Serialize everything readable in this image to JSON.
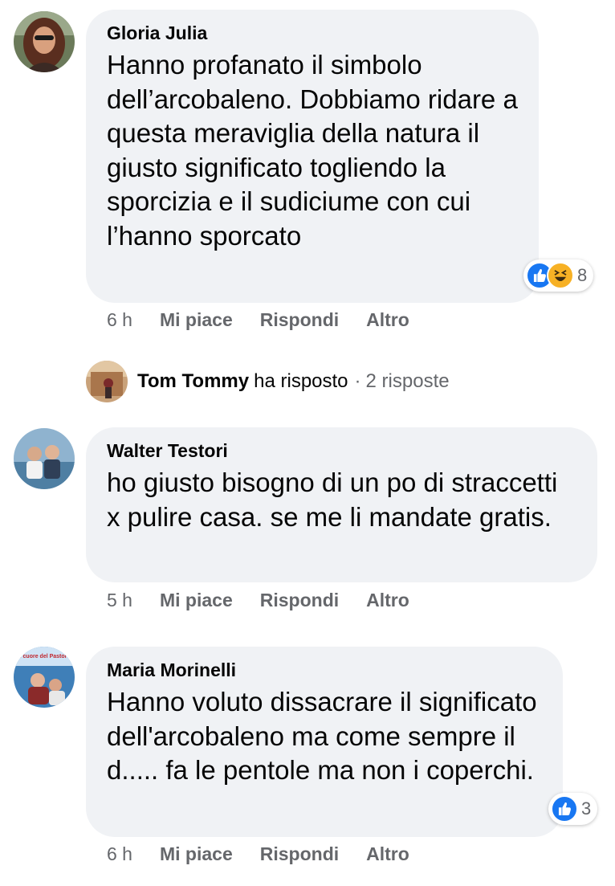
{
  "comments": [
    {
      "author": "Gloria Julia",
      "text": "Hanno profanato il simbolo dell’arcobaleno. Dobbiamo ridare a questa meraviglia della natura il giusto significato togliendo la sporcizia e il sudiciume con cui l’hanno sporcato",
      "time": "6 h",
      "like": "Mi piace",
      "reply": "Rispondi",
      "more": "Altro",
      "reaction_count": "8",
      "reaction_icons": [
        "like-icon",
        "haha-icon"
      ]
    },
    {
      "author": "Walter Testori",
      "text": "ho giusto bisogno di un po di straccetti x pulire casa. se me li mandate gratis.",
      "time": "5 h",
      "like": "Mi piace",
      "reply": "Rispondi",
      "more": "Altro"
    },
    {
      "author": "Maria Morinelli",
      "text": "Hanno voluto dissacrare il significato dell'arcobaleno ma come sempre il d..... fa le pentole ma non i coperchi.",
      "time": "6 h",
      "like": "Mi piace",
      "reply": "Rispondi",
      "more": "Altro",
      "reaction_count": "3",
      "reaction_icons": [
        "like-icon"
      ]
    }
  ],
  "reply_summary": {
    "name": "Tom Tommy",
    "verb": "ha risposto",
    "separator": "·",
    "count": "2 risposte"
  },
  "avatar_text": {
    "maria": "il cuore del Pastore"
  },
  "colors": {
    "bubble": "#f0f2f5",
    "secondary_text": "#65676b",
    "like_blue": "#1877f2",
    "haha_yellow": "#f7b125"
  }
}
